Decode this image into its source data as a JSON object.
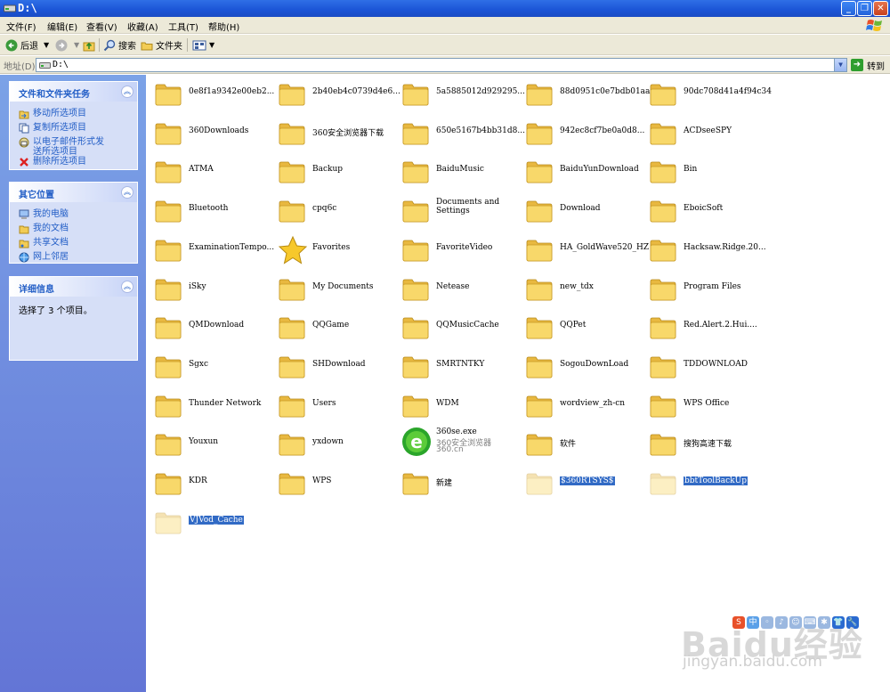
{
  "window": {
    "title": "D:\\"
  },
  "menu": [
    "文件(F)",
    "编辑(E)",
    "查看(V)",
    "收藏(A)",
    "工具(T)",
    "帮助(H)"
  ],
  "toolbar": {
    "back": "后退",
    "search": "搜索",
    "folders": "文件夹"
  },
  "address": {
    "label": "地址(D)",
    "value": "D:\\",
    "go": "转到"
  },
  "sidebar": {
    "tasks": {
      "title": "文件和文件夹任务",
      "items": [
        "移动所选项目",
        "复制所选项目",
        "以电子邮件形式发送所选项目",
        "删除所选项目"
      ]
    },
    "places": {
      "title": "其它位置",
      "items": [
        "我的电脑",
        "我的文档",
        "共享文档",
        "网上邻居"
      ]
    },
    "details": {
      "title": "详细信息",
      "text": "选择了 3 个项目。"
    }
  },
  "items": [
    {
      "name": "0e8f1a9342e00eb2..."
    },
    {
      "name": "2b40eb4c0739d4e6..."
    },
    {
      "name": "5a5885012d929295..."
    },
    {
      "name": "88d0951c0e7bdb01aa"
    },
    {
      "name": "90dc708d41a4f94c34"
    },
    {
      "name": "360Downloads"
    },
    {
      "name": "360安全浏览器下载"
    },
    {
      "name": "650e5167b4bb31d8..."
    },
    {
      "name": "942ec8cf7be0a0d8..."
    },
    {
      "name": "ACDseeSPY"
    },
    {
      "name": "ATMA"
    },
    {
      "name": "Backup"
    },
    {
      "name": "BaiduMusic"
    },
    {
      "name": "BaiduYunDownload"
    },
    {
      "name": "Bin"
    },
    {
      "name": "Bluetooth"
    },
    {
      "name": "cpq6c"
    },
    {
      "name": "Documents and Settings"
    },
    {
      "name": "Download"
    },
    {
      "name": "EboicSoft"
    },
    {
      "name": "ExaminationTempo..."
    },
    {
      "name": "Favorites",
      "icon": "star"
    },
    {
      "name": "FavoriteVideo"
    },
    {
      "name": "HA_GoldWave520_HZ"
    },
    {
      "name": "Hacksaw.Ridge.20..."
    },
    {
      "name": "iSky"
    },
    {
      "name": "My Documents"
    },
    {
      "name": "Netease"
    },
    {
      "name": "new_tdx"
    },
    {
      "name": "Program Files"
    },
    {
      "name": "QMDownload"
    },
    {
      "name": "QQGame"
    },
    {
      "name": "QQMusicCache"
    },
    {
      "name": "QQPet"
    },
    {
      "name": "Red.Alert.2.Hui...."
    },
    {
      "name": "Sgxc"
    },
    {
      "name": "SHDownload"
    },
    {
      "name": "SMRTNTKY"
    },
    {
      "name": "SogouDownLoad"
    },
    {
      "name": "TDDOWNLOAD"
    },
    {
      "name": "Thunder Network"
    },
    {
      "name": "Users"
    },
    {
      "name": "WDM"
    },
    {
      "name": "wordview_zh-cn"
    },
    {
      "name": "WPS Office"
    },
    {
      "name": "Youxun"
    },
    {
      "name": "yxdown"
    },
    {
      "name": "360se.exe",
      "icon": "exe",
      "sub1": "360安全浏览器",
      "sub2": "360.cn"
    },
    {
      "name": "软件"
    },
    {
      "name": "搜狗高速下载"
    },
    {
      "name": "KDR"
    },
    {
      "name": "WPS"
    },
    {
      "name": "新建"
    },
    {
      "name": "$360RTSYS$",
      "selected": true,
      "hidden": true
    },
    {
      "name": "bbtToolBackUp",
      "selected": true,
      "hidden": true
    },
    {
      "name": "VJVod_Cache",
      "selected": true,
      "hidden": true
    }
  ],
  "watermark": {
    "logo": "Baidu经验",
    "url": "jingyan.baidu.com"
  },
  "colors": {
    "titlebar": "#1b54d6",
    "selection": "#316ac5",
    "link": "#215dc6",
    "folder": "#f6d35f"
  }
}
